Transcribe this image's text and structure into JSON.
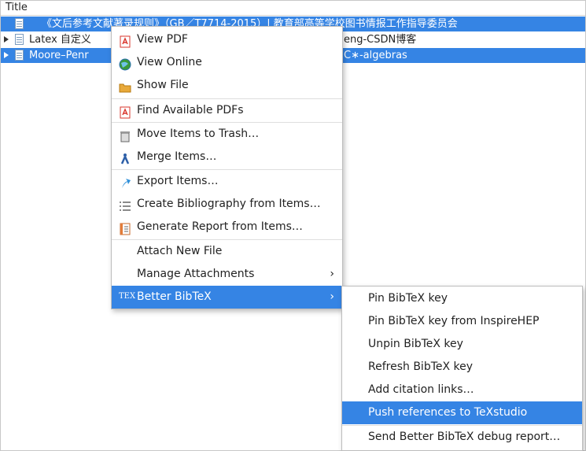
{
  "column_header": "Title",
  "rows": [
    {
      "title": "《文后参考文献著录规则》（GB／T7714-2015）| 教育部高等学校图书情报工作指导委员会",
      "selected": true,
      "has_children": false
    },
    {
      "title_left": "Latex 自定义",
      "title_right": "eng-CSDN博客",
      "selected": false,
      "has_children": true
    },
    {
      "title_left": "Moore–Penr",
      "title_right": "C∗-algebras",
      "selected": true,
      "has_children": true
    }
  ],
  "context_menu": {
    "items": [
      {
        "label": "View PDF",
        "icon": "pdf-icon"
      },
      {
        "label": "View Online",
        "icon": "globe-icon"
      },
      {
        "label": "Show File",
        "icon": "folder-icon"
      },
      {
        "label": "Find Available PDFs",
        "icon": "pdf-icon"
      },
      {
        "label": "Move Items to Trash…",
        "icon": "trash-icon"
      },
      {
        "label": "Merge Items…",
        "icon": "merge-icon"
      },
      {
        "label": "Export Items…",
        "icon": "export-icon"
      },
      {
        "label": "Create Bibliography from Items…",
        "icon": "bibliography-icon"
      },
      {
        "label": "Generate Report from Items…",
        "icon": "report-icon"
      },
      {
        "label": "Attach New File",
        "icon": ""
      },
      {
        "label": "Manage Attachments",
        "icon": "",
        "arrow": "›"
      },
      {
        "label": "Better BibTeX",
        "icon": "tex-icon",
        "icon_text": "TEX",
        "arrow": "›",
        "active": true
      }
    ]
  },
  "submenu": {
    "items": [
      {
        "label": "Pin BibTeX key"
      },
      {
        "label": "Pin BibTeX key from InspireHEP"
      },
      {
        "label": "Unpin BibTeX key"
      },
      {
        "label": "Refresh BibTeX key"
      },
      {
        "label": "Add citation links…"
      },
      {
        "label": "Push references to TeXstudio",
        "active": true
      },
      {
        "label": "Send Better BibTeX debug report…"
      }
    ]
  },
  "colors": {
    "accent": "#3584e4",
    "pdf": "#d9342b",
    "globe": "#3a9a3a",
    "folder": "#e8a93a"
  }
}
